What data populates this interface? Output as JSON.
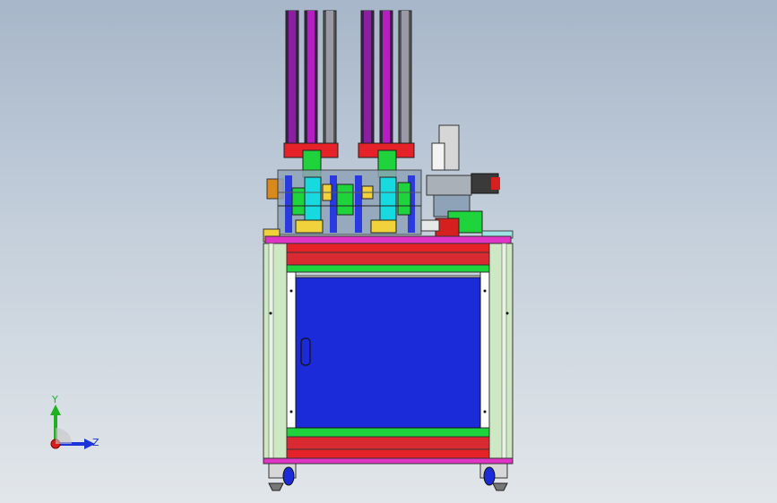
{
  "viewport": {
    "background_top": "#a7b6c9",
    "background_bottom": "#e2e6ea"
  },
  "triad": {
    "y_label": "Y",
    "z_label": "Z",
    "y_color": "#1fb11f",
    "z_color": "#1b35d8",
    "x_color": "#d61e1e"
  },
  "colors": {
    "frame_green": "#cfe8c4",
    "panel_blue": "#1c2bd9",
    "red_rail": "#e42228",
    "green_rail": "#1ed33c",
    "magenta_base": "#e035c4",
    "pillar_purple": "#8a1fa0",
    "pillar_grey": "#8a8a96",
    "cyan_part": "#17d9e0",
    "yellow_part": "#f2d23a"
  }
}
